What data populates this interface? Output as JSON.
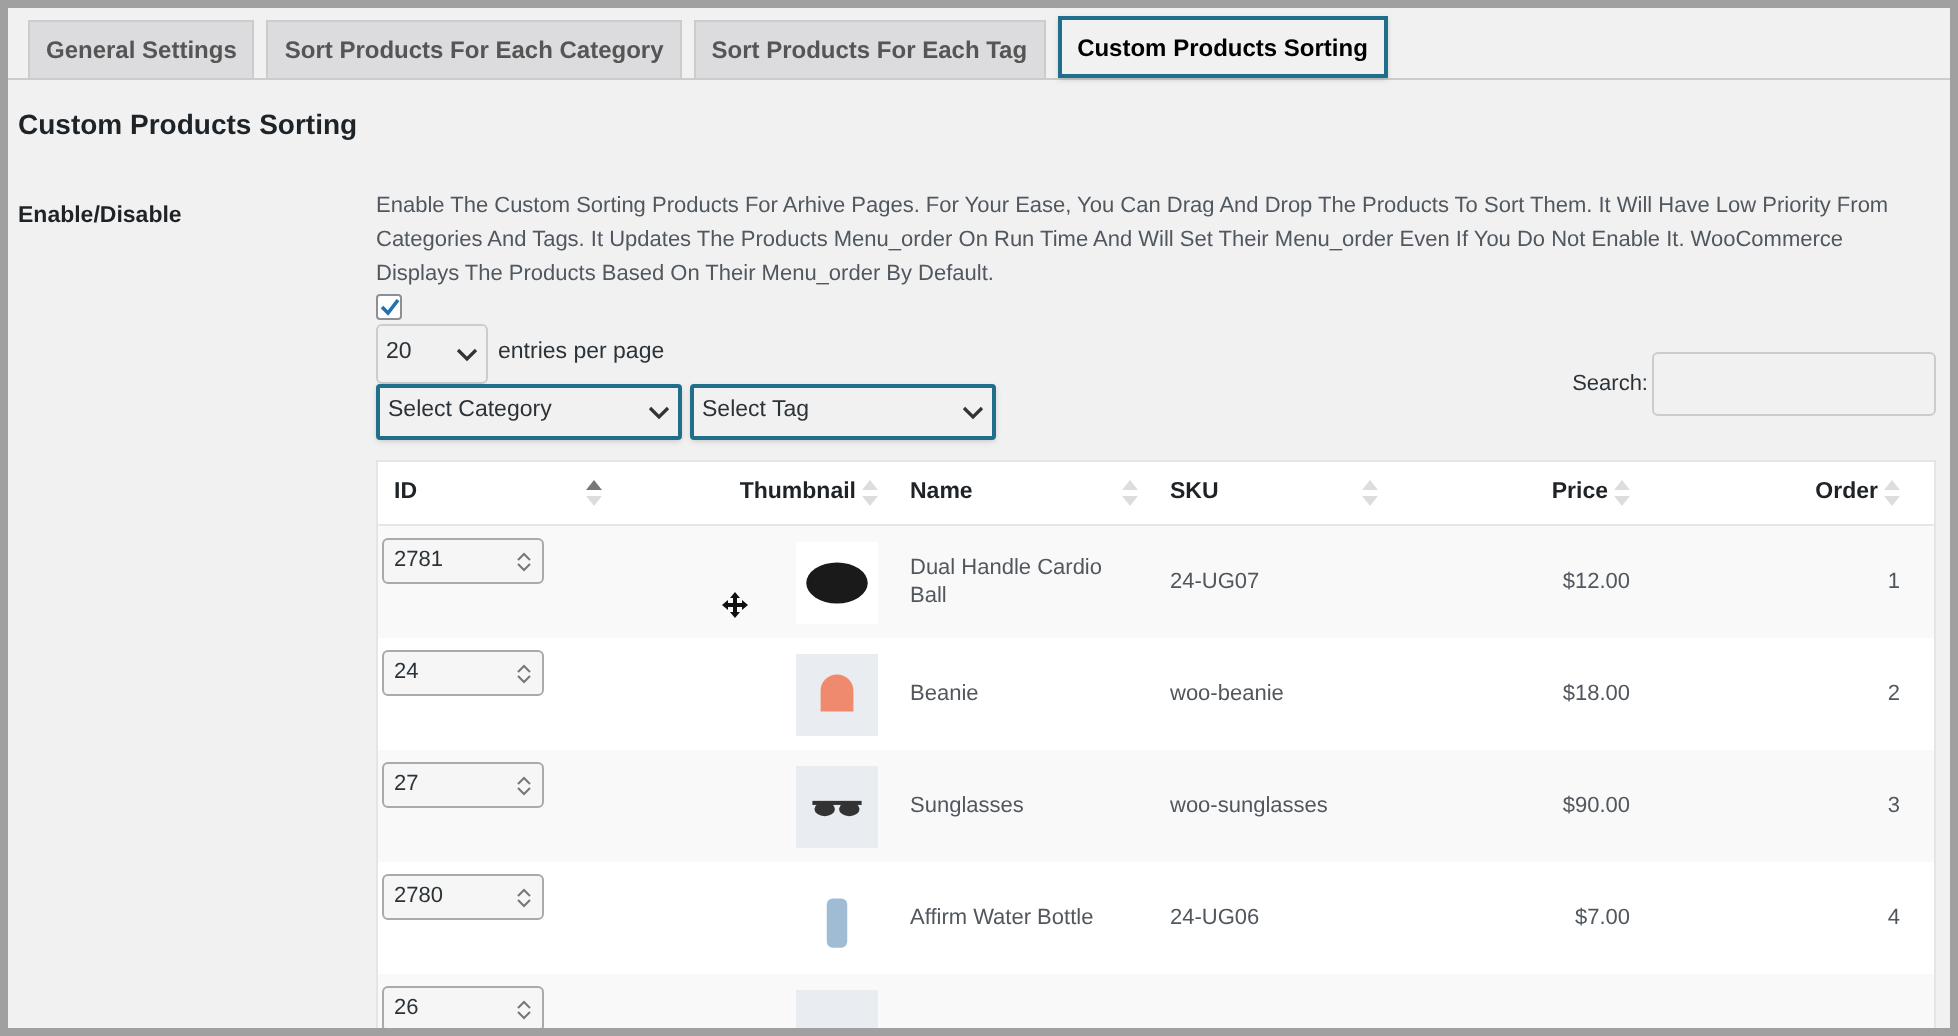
{
  "tabs": [
    {
      "label": "General Settings",
      "selected": false
    },
    {
      "label": "Sort Products For Each Category",
      "selected": false
    },
    {
      "label": "Sort Products For Each Tag",
      "selected": false
    },
    {
      "label": "Custom Products Sorting",
      "selected": true
    }
  ],
  "heading": "Custom Products Sorting",
  "setting": {
    "label": "Enable/Disable",
    "description": "Enable The Custom Sorting Products For Arhive Pages. For Your Ease, You Can Drag And Drop The Products To Sort Them. It Will Have Low Priority From Categories And Tags. It Updates The Products Menu_order On Run Time And Will Set Their Menu_order Even If You Do Not Enable It. WooCommerce Displays The Products Based On Their Menu_order By Default.",
    "checked": true
  },
  "entries": {
    "value": "20",
    "label": "entries per page"
  },
  "filters": [
    {
      "value": "Select Category"
    },
    {
      "value": "Select Tag"
    }
  ],
  "search": {
    "label": "Search:"
  },
  "table": {
    "columns": [
      {
        "label": "ID",
        "sorted": true,
        "kind": "left"
      },
      {
        "label": "Thumbnail",
        "sorted": false,
        "kind": "right"
      },
      {
        "label": "Name",
        "sorted": false,
        "kind": "left"
      },
      {
        "label": "SKU",
        "sorted": false,
        "kind": "left"
      },
      {
        "label": "Price",
        "sorted": false,
        "kind": "right"
      },
      {
        "label": "Order",
        "sorted": false,
        "kind": "right"
      }
    ],
    "rows": [
      {
        "id": "2781",
        "kind": "ball",
        "name": "Dual Handle Cardio Ball",
        "sku": "24-UG07",
        "price": "$12.00",
        "order": "1"
      },
      {
        "id": "24",
        "kind": "beanie",
        "name": "Beanie",
        "sku": "woo-beanie",
        "price": "$18.00",
        "order": "2"
      },
      {
        "id": "27",
        "kind": "sunglasses",
        "name": "Sunglasses",
        "sku": "woo-sunglasses",
        "price": "$90.00",
        "order": "3"
      },
      {
        "id": "2780",
        "kind": "bottle",
        "name": "Affirm Water Bottle",
        "sku": "24-UG06",
        "price": "$7.00",
        "order": "4"
      },
      {
        "id": "26",
        "kind": "blank"
      }
    ]
  }
}
